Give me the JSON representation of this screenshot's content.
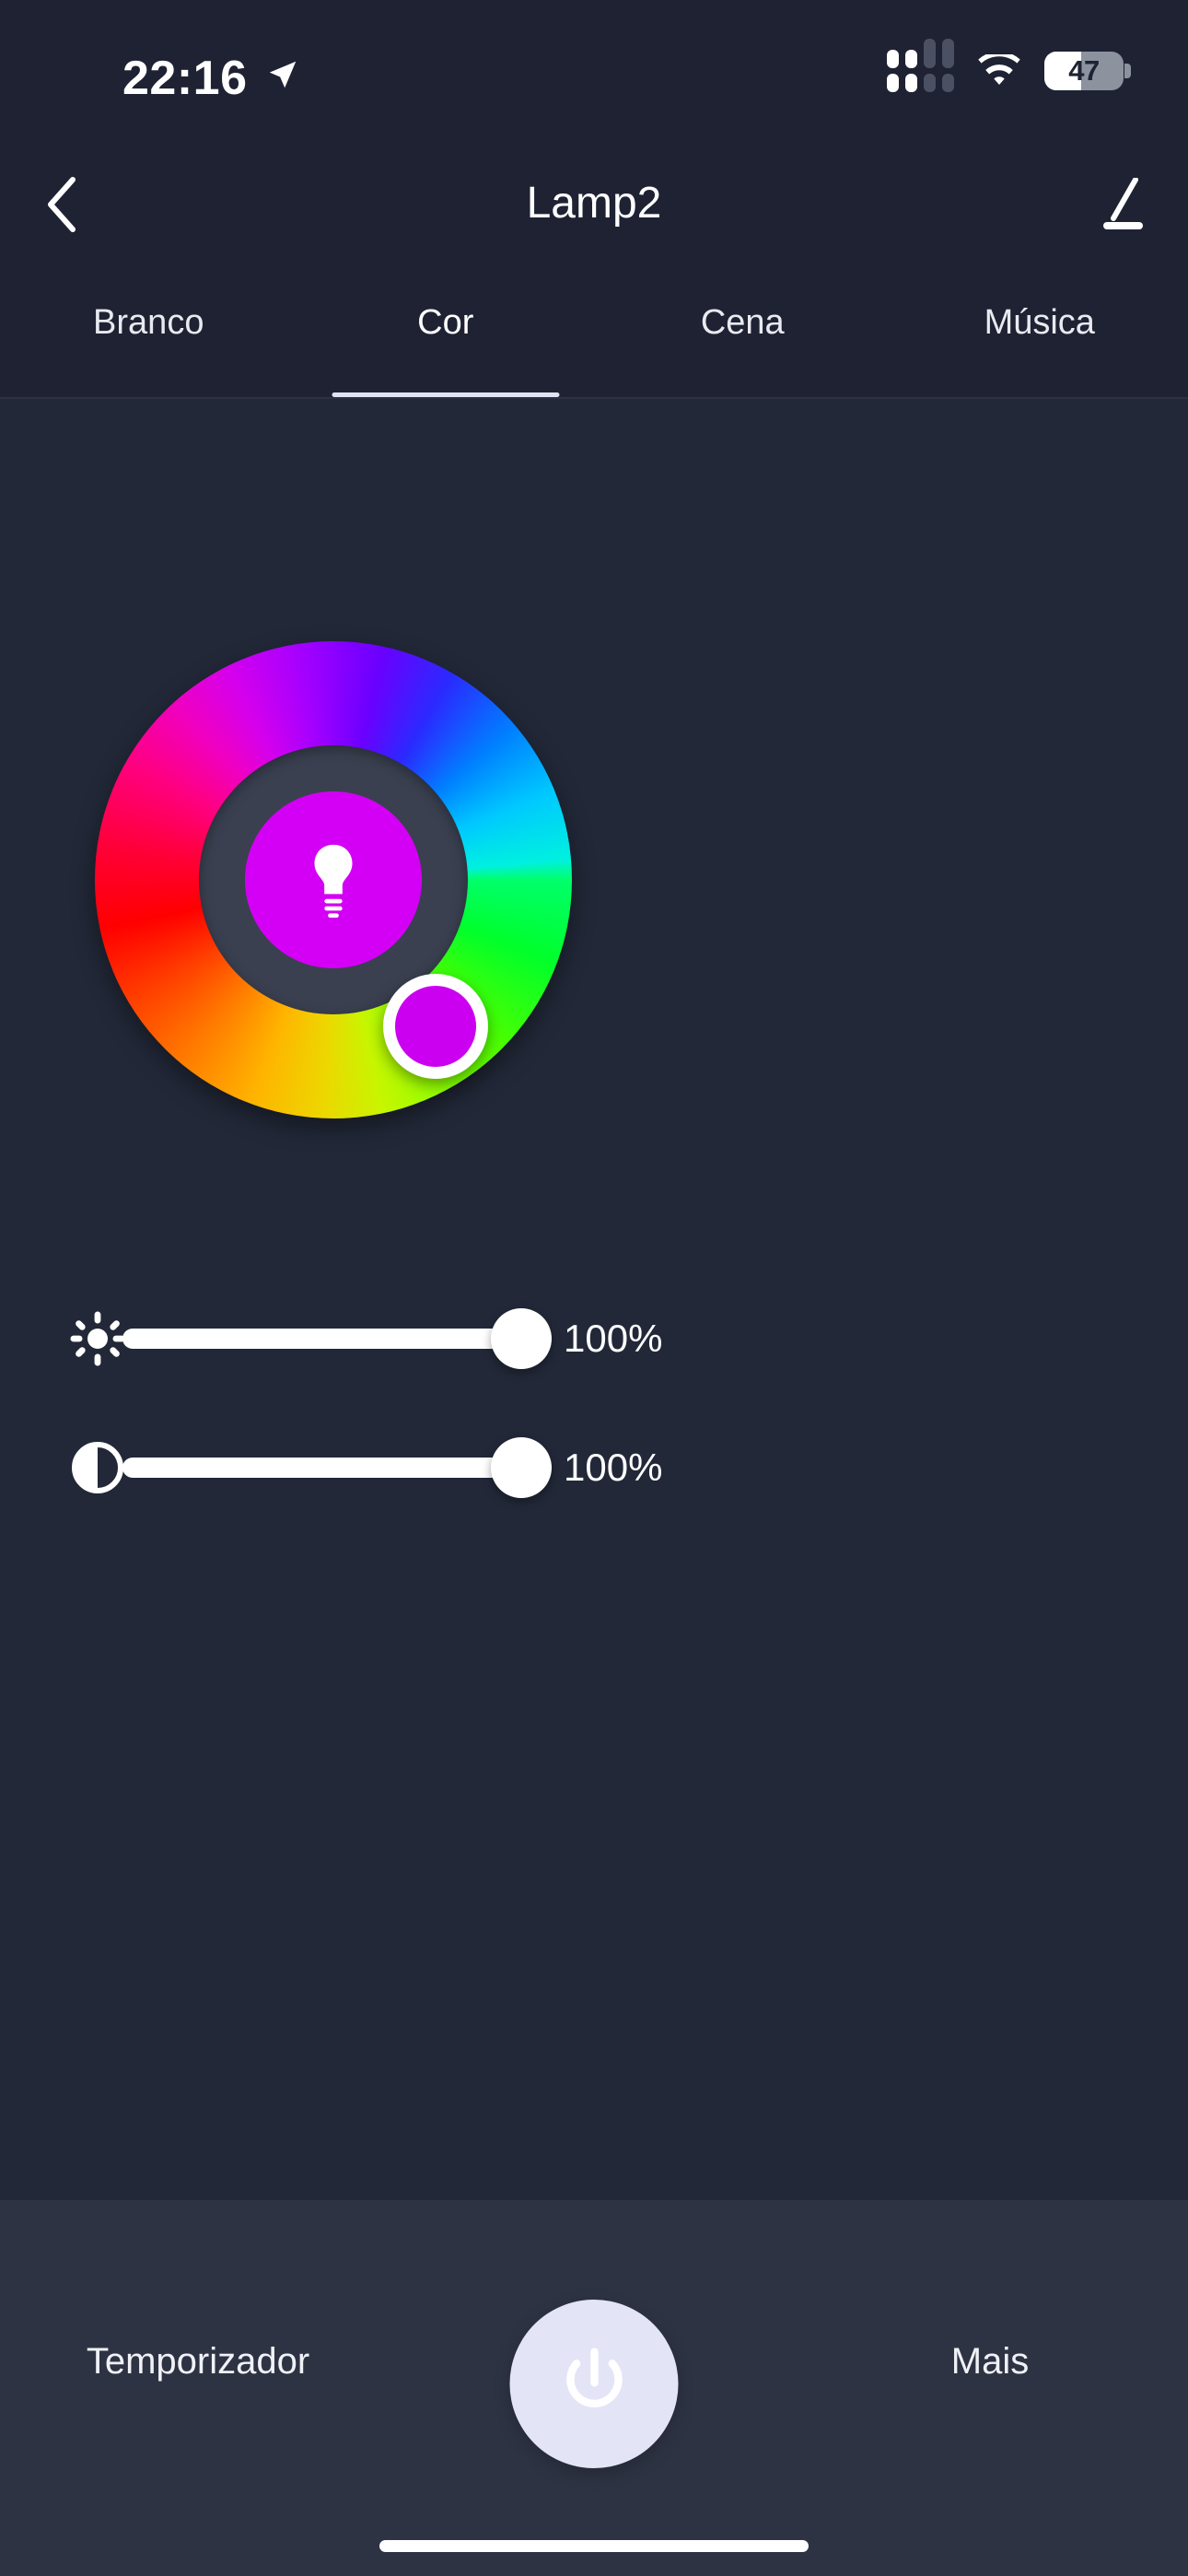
{
  "status_bar": {
    "time": "22:16",
    "location_icon": "location-arrow-icon",
    "signal_icon": "cellular-signal-icon",
    "wifi_icon": "wifi-icon",
    "battery_percent_label": "47",
    "battery_level": 47
  },
  "nav_bar": {
    "back_icon": "chevron-left-icon",
    "title": "Lamp2",
    "edit_icon": "pencil-edit-icon"
  },
  "tabs": {
    "active_index": 1,
    "items": [
      {
        "label": "Branco"
      },
      {
        "label": "Cor"
      },
      {
        "label": "Cena"
      },
      {
        "label": "Música"
      }
    ]
  },
  "color_wheel": {
    "name": "hue-color-wheel",
    "selected_color": "#cc00f0",
    "center_swatch_color": "#d400f5",
    "center_icon": "light-bulb-icon",
    "handle_angle_deg": 55,
    "ring_colors": [
      "#00ff6a",
      "#4cff00",
      "#c8f500",
      "#ecd800",
      "#ffb400",
      "#ff7a00",
      "#ff0000",
      "#ff0080",
      "#d400ee",
      "#a400ff",
      "#2a2aff",
      "#0080ff",
      "#00c8ff",
      "#00f0e0"
    ]
  },
  "sliders": [
    {
      "name": "brightness",
      "icon": "brightness-sun-icon",
      "value": 100,
      "value_label": "100%"
    },
    {
      "name": "saturation",
      "icon": "contrast-half-circle-icon",
      "value": 100,
      "value_label": "100%"
    }
  ],
  "bottom_bar": {
    "timer_label": "Temporizador",
    "power_icon": "power-button-icon",
    "more_label": "Mais"
  },
  "colors": {
    "background": "#222838",
    "header_background": "#1e2233",
    "bottom_bar_background": "#2e3344",
    "accent_white": "#ffffff",
    "tab_underline": "#dfe3f2",
    "power_button": "#e3e4f6"
  }
}
